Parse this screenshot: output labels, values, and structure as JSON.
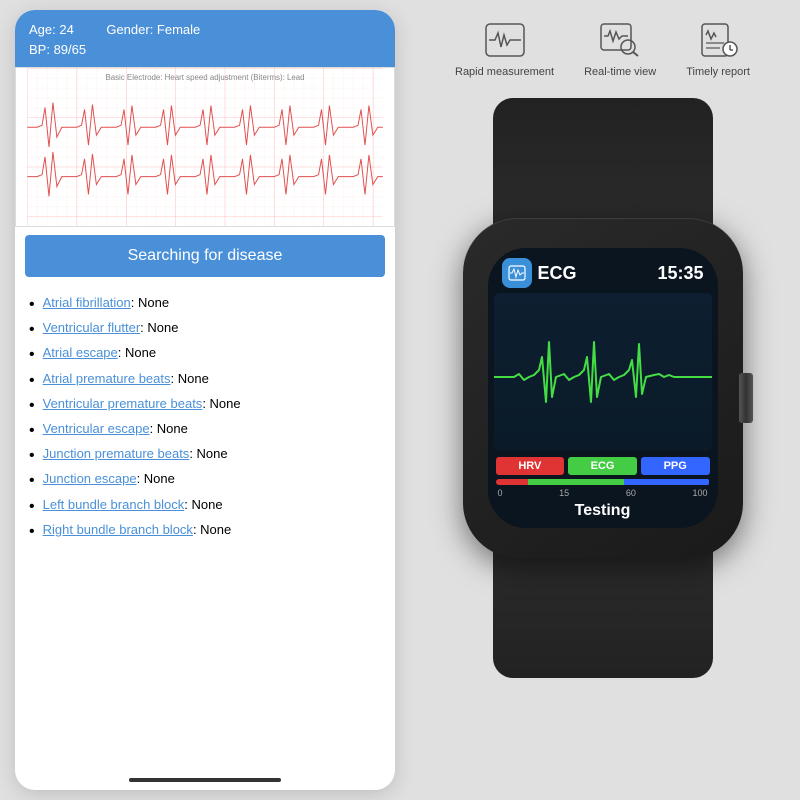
{
  "phone": {
    "header": {
      "age_label": "Age: 24",
      "gender_label": "Gender: Female",
      "bp_label": "BP: 89/65"
    },
    "search_button": "Searching for disease",
    "disease_items": [
      {
        "name": "Atrial fibrillation",
        "value": "None"
      },
      {
        "name": "Ventricular flutter",
        "value": "None"
      },
      {
        "name": "Atrial escape",
        "value": "None"
      },
      {
        "name": "Atrial premature beats",
        "value": "None"
      },
      {
        "name": "Ventricular premature beats",
        "value": "None"
      },
      {
        "name": "Ventricular escape",
        "value": "None"
      },
      {
        "name": "Junction premature beats",
        "value": "None"
      },
      {
        "name": "Junction escape",
        "value": "None"
      },
      {
        "name": "Left bundle branch block",
        "value": "None"
      },
      {
        "name": "Right bundle branch block",
        "value": "None"
      }
    ]
  },
  "watch": {
    "app_label": "ECG",
    "time": "15:35",
    "status": "Testing",
    "badges": {
      "hrv": "HRV",
      "ecg": "ECG",
      "ppg": "PPG"
    },
    "progress_labels": [
      "0",
      "15",
      "60",
      "100"
    ]
  },
  "features": [
    {
      "label": "Rapid measurement",
      "icon": "ecg-icon"
    },
    {
      "label": "Real-time view",
      "icon": "search-ecg-icon"
    },
    {
      "label": "Timely report",
      "icon": "report-icon"
    }
  ]
}
